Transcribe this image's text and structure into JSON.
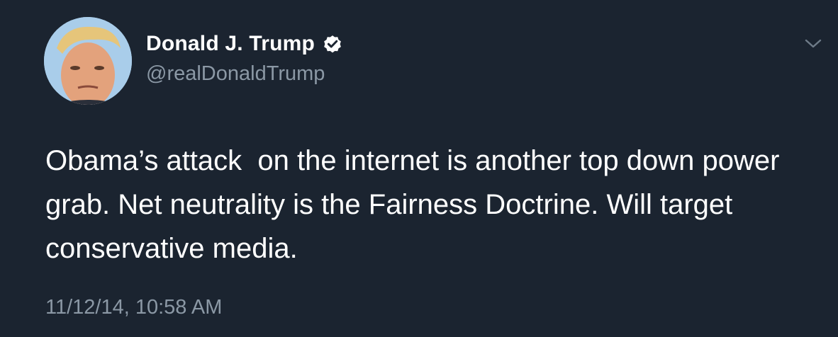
{
  "tweet": {
    "author": {
      "display_name": "Donald J. Trump",
      "handle": "@realDonaldTrump",
      "verified": true,
      "verified_icon": "verified-badge-icon",
      "avatar_icon": "profile-photo"
    },
    "menu_icon": "chevron-down-icon",
    "text": "Obama’s attack  on the internet is another top down power grab. Net neutrality is the Fairness Doctrine. Will target conservative media.",
    "timestamp": "11/12/14, 10:58 AM"
  },
  "colors": {
    "background": "#1b2430",
    "primary_text": "#ffffff",
    "secondary_text": "#8b98a5"
  }
}
